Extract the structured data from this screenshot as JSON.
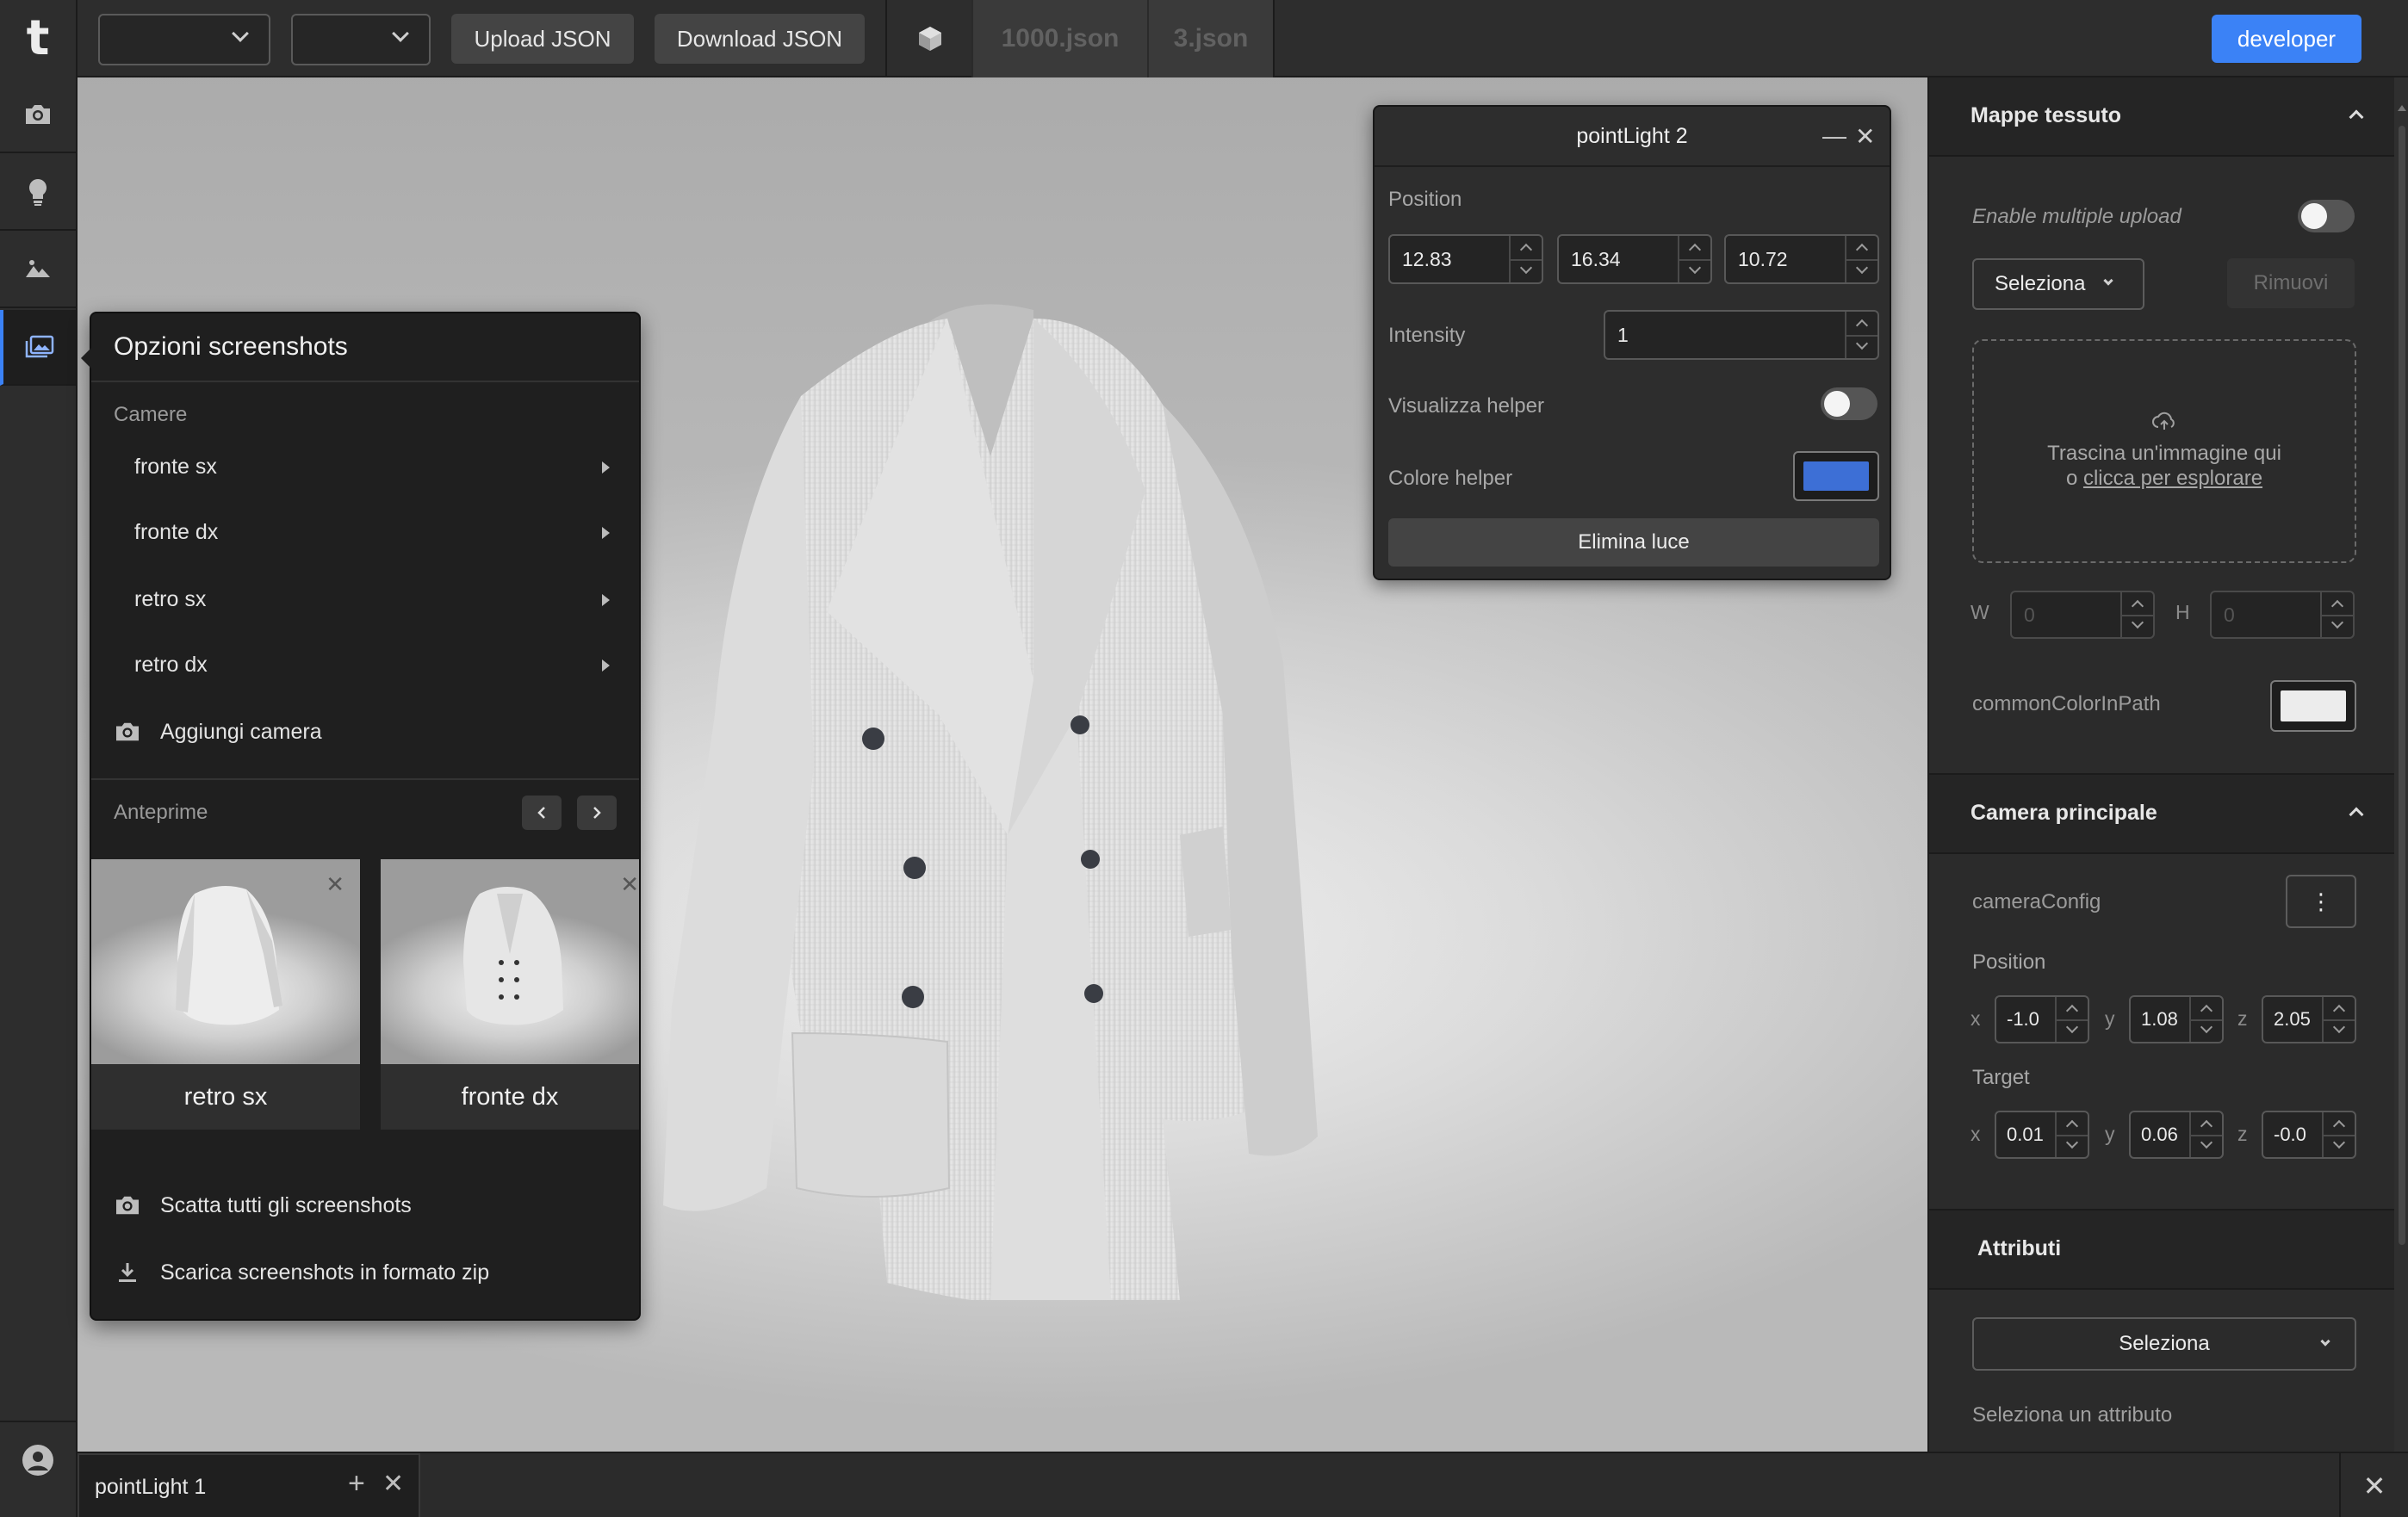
{
  "topbar": {
    "upload_label": "Upload JSON",
    "download_label": "Download JSON",
    "file_tabs": [
      "1000.json",
      "3.json"
    ],
    "developer_label": "developer",
    "accent": "#3b82f6"
  },
  "leftrail": {
    "icons": [
      "camera-icon",
      "lightbulb-icon",
      "landscape-icon",
      "gallery-icon"
    ],
    "active_index": 3,
    "user_icon": "user-avatar-icon"
  },
  "screenshots": {
    "title": "Opzioni screenshots",
    "cameras_label": "Camere",
    "cameras": [
      "fronte sx",
      "fronte dx",
      "retro sx",
      "retro dx"
    ],
    "add_camera": "Aggiungi camera",
    "previews_label": "Anteprime",
    "previews": [
      "retro sx",
      "fronte dx"
    ],
    "take_all": "Scatta tutti gli screenshots",
    "download_zip": "Scarica screenshots in formato zip"
  },
  "pointlight": {
    "title": "pointLight 2",
    "position_label": "Position",
    "position": [
      "12.83",
      "16.34",
      "10.72"
    ],
    "intensity_label": "Intensity",
    "intensity": "1",
    "helper_label": "Visualizza helper",
    "helper_on": false,
    "color_label": "Colore helper",
    "color": "#3d6fd6",
    "delete_label": "Elimina luce"
  },
  "rightpanel": {
    "maps": {
      "title": "Mappe tessuto",
      "multi_upload": "Enable multiple upload",
      "select_label": "Seleziona",
      "remove_label": "Rimuovi",
      "drop_line1": "Trascina un'immagine qui",
      "drop_prefix": "o ",
      "drop_link": "clicca per esplorare",
      "w_label": "W",
      "h_label": "H",
      "w_value": "0",
      "h_value": "0",
      "common_color_label": "commonColorInPath",
      "common_color": "#ececec"
    },
    "camera": {
      "title": "Camera principale",
      "config_label": "cameraConfig",
      "position_label": "Position",
      "target_label": "Target",
      "axes": [
        "x",
        "y",
        "z"
      ],
      "position": [
        "-1.0",
        "1.08",
        "2.05"
      ],
      "target": [
        "0.01",
        "0.06",
        "-0.0"
      ]
    },
    "attributes": {
      "title": "Attributi",
      "select_label": "Seleziona",
      "hint": "Seleziona un attributo"
    }
  },
  "bottombar": {
    "tab_label": "pointLight 1"
  }
}
